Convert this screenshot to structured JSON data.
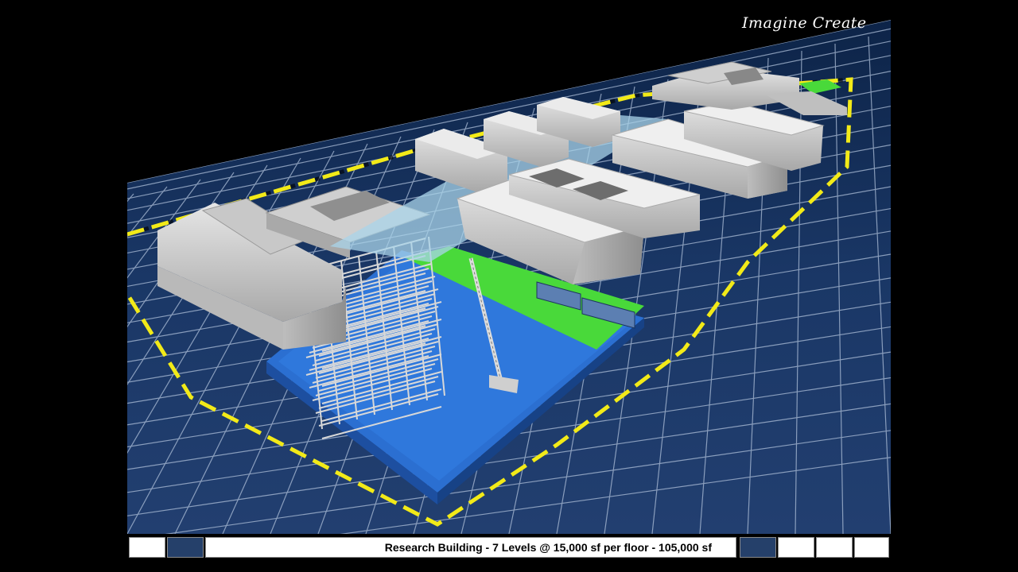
{
  "video": {
    "brand_text": "Imagine Create",
    "caption": "Research Building - 7 Levels @ 15,000 sf per floor - 105,000 sf"
  },
  "colors": {
    "ground": "#1a3766",
    "grid_lines": "#aebfd8",
    "boundary": "#f2ea18",
    "site_pool": "#2b6fd1",
    "lawn": "#49d93a",
    "building": "#d4d4d4"
  }
}
